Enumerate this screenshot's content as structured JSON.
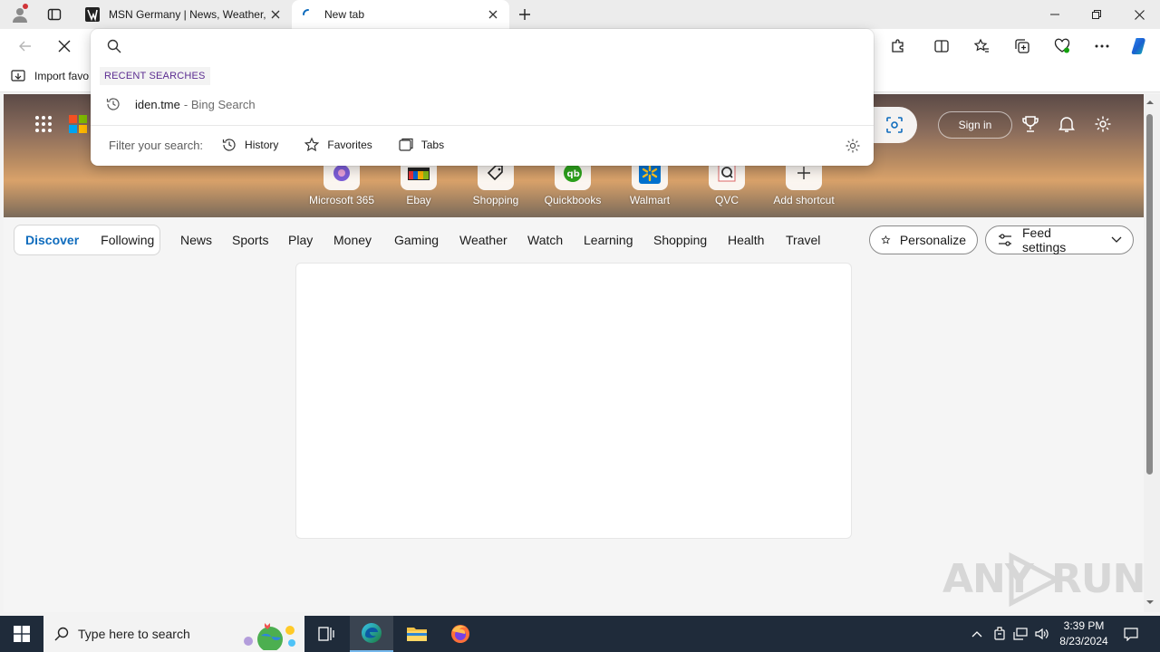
{
  "browser": {
    "tabs": [
      {
        "title": "MSN Germany | News, Weather,",
        "active": false
      },
      {
        "title": "New tab",
        "active": true
      }
    ],
    "favorites_bar": {
      "import_label": "Import favo"
    }
  },
  "omnibox": {
    "value": "",
    "recent_label": "RECENT SEARCHES",
    "recent_items": [
      {
        "query": "iden.tme",
        "suffix": "- Bing Search"
      }
    ],
    "filter_label": "Filter your search:",
    "filters": [
      "History",
      "Favorites",
      "Tabs"
    ]
  },
  "newtab": {
    "sign_in": "Sign in",
    "shortcuts": [
      "Microsoft 365",
      "Ebay",
      "Shopping",
      "Quickbooks",
      "Walmart",
      "QVC",
      "Add shortcut"
    ],
    "feed_tabs": [
      "Discover",
      "Following"
    ],
    "categories": [
      "News",
      "Sports",
      "Play",
      "Money",
      "Gaming",
      "Weather",
      "Watch",
      "Learning",
      "Shopping",
      "Health",
      "Travel"
    ],
    "personalize": "Personalize",
    "feed_settings": "Feed settings"
  },
  "watermark": {
    "text_left": "ANY",
    "text_right": "RUN"
  },
  "taskbar": {
    "search_placeholder": "Type here to search",
    "time": "3:39 PM",
    "date": "8/23/2024"
  },
  "colors": {
    "accent": "#0f6cbd",
    "taskbar": "#1f2b3a",
    "recent_label": "#5c2d91"
  }
}
